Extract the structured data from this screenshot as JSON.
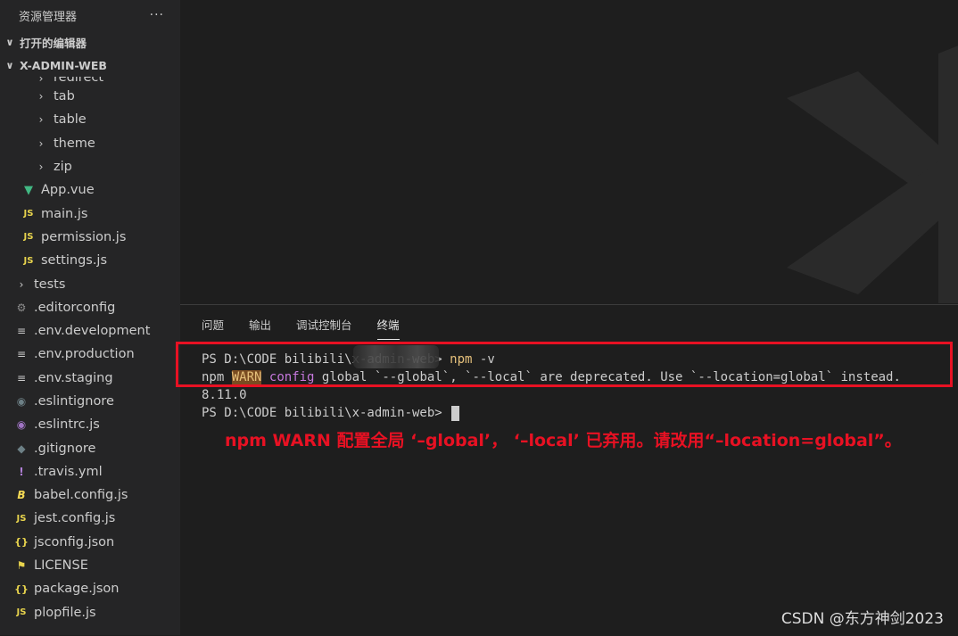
{
  "sidebar": {
    "title": "资源管理器",
    "more": "···",
    "open_editors": "打开的编辑器",
    "project": "X-ADMIN-WEB",
    "items": [
      {
        "label": "redirect",
        "icon": "chevron-right-icon",
        "glyph": "›"
      },
      {
        "label": "tab",
        "icon": "chevron-right-icon",
        "glyph": "›"
      },
      {
        "label": "table",
        "icon": "chevron-right-icon",
        "glyph": "›"
      },
      {
        "label": "theme",
        "icon": "chevron-right-icon",
        "glyph": "›"
      },
      {
        "label": "zip",
        "icon": "chevron-right-icon",
        "glyph": "›"
      },
      {
        "label": "App.vue",
        "icon": "vue-icon",
        "glyph": "▼"
      },
      {
        "label": "main.js",
        "icon": "js-icon",
        "glyph": "JS"
      },
      {
        "label": "permission.js",
        "icon": "js-icon",
        "glyph": "JS"
      },
      {
        "label": "settings.js",
        "icon": "js-icon",
        "glyph": "JS"
      },
      {
        "label": "tests",
        "icon": "chevron-right-icon",
        "glyph": "›"
      },
      {
        "label": ".editorconfig",
        "icon": "gear-icon",
        "glyph": "⚙"
      },
      {
        "label": ".env.development",
        "icon": "lines-icon",
        "glyph": "≡"
      },
      {
        "label": ".env.production",
        "icon": "lines-icon",
        "glyph": "≡"
      },
      {
        "label": ".env.staging",
        "icon": "lines-icon",
        "glyph": "≡"
      },
      {
        "label": ".eslintignore",
        "icon": "circle-icon",
        "glyph": "◉"
      },
      {
        "label": ".eslintrc.js",
        "icon": "eslint-icon",
        "glyph": "◉"
      },
      {
        "label": ".gitignore",
        "icon": "git-icon",
        "glyph": "◆"
      },
      {
        "label": ".travis.yml",
        "icon": "exclamation-icon",
        "glyph": "!"
      },
      {
        "label": "babel.config.js",
        "icon": "babel-icon",
        "glyph": "B"
      },
      {
        "label": "jest.config.js",
        "icon": "js-icon",
        "glyph": "JS"
      },
      {
        "label": "jsconfig.json",
        "icon": "json-icon",
        "glyph": "{}"
      },
      {
        "label": "LICENSE",
        "icon": "license-icon",
        "glyph": "⚑"
      },
      {
        "label": "package.json",
        "icon": "json-icon",
        "glyph": "{}"
      },
      {
        "label": "plopfile.js",
        "icon": "js-icon",
        "glyph": "JS"
      }
    ]
  },
  "panel": {
    "tabs": [
      "问题",
      "输出",
      "调试控制台",
      "终端"
    ],
    "active_tab": "终端"
  },
  "terminal": {
    "line1_prompt": "PS D:\\CODE bilibili\\x-admin-web>",
    "line1_cmd": "npm",
    "line1_arg": "-v",
    "line2_npm": "npm",
    "line2_warn": "WARN",
    "line2_config": "config",
    "line2_rest": "global `--global`, `--local` are deprecated. Use `--location=global` instead.",
    "line3": "8.11.0",
    "line4_prompt": "PS D:\\CODE bilibili\\x-admin-web>"
  },
  "annotation": "npm WARN 配置全局 ‘–global’， ‘–local’ 已弃用。请改用“–location=global”。",
  "watermark": "CSDN @东方神剑2023",
  "colors": {
    "accent_red": "#e81123",
    "sidebar_bg": "#252526",
    "editor_bg": "#1e1e1e"
  }
}
